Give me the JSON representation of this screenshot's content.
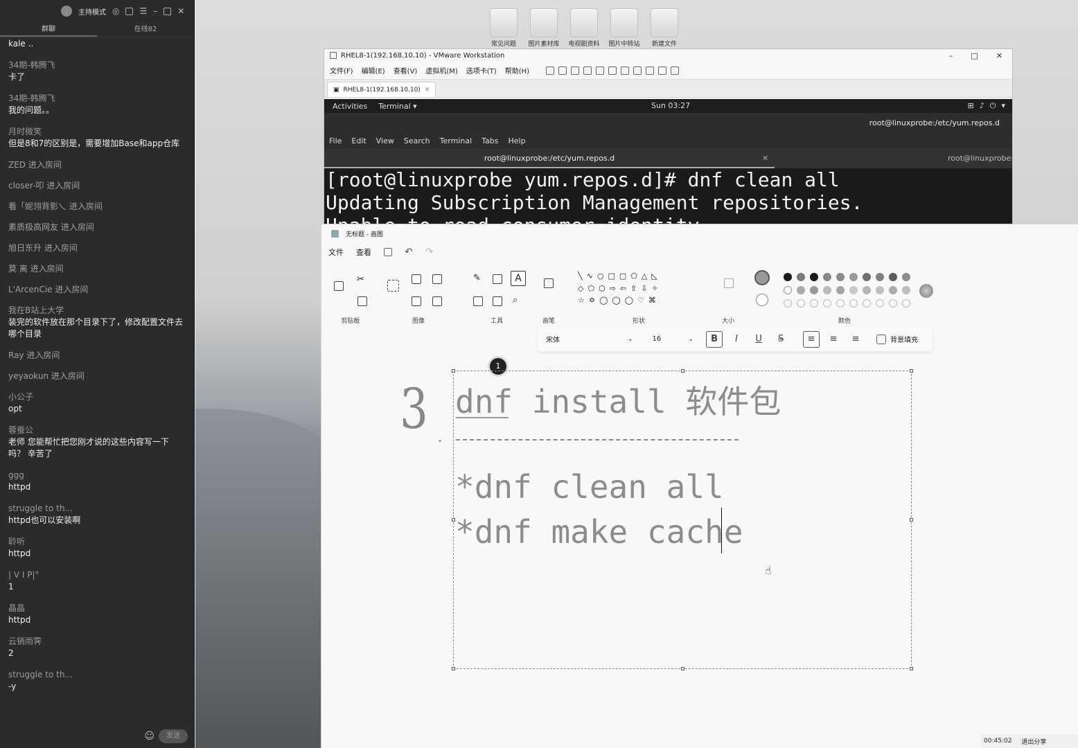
{
  "chat": {
    "header_title": "主持模式",
    "tabs": [
      "群聊",
      "在线82"
    ],
    "messages": [
      {
        "user": "34期-韩腾飞",
        "text": "kale .."
      },
      {
        "user": "34期-韩腾飞",
        "text": "卡了"
      },
      {
        "user": "34期-韩腾飞",
        "text": "我的问题。。"
      },
      {
        "user": "月时微笑",
        "text": "但是8和7的区别是，需要增加Base和app仓库"
      }
    ],
    "joins": [
      "ZED 进入房间",
      "closer-叩    进入房间",
      "看「妮翎背影乀 进入房间",
      "素质极高网友 进入房间",
      "旭日东升 进入房间",
      "莫 离 进入房间",
      "L'ArcenCie 进入房间"
    ],
    "messages2": [
      {
        "user": "我在B站上大学",
        "text": "装完的软件放在那个目录下了，修改配置文件去哪个目录"
      }
    ],
    "joins2": [
      "Ray 进入房间",
      "yeyaokun 进入房间"
    ],
    "messages3": [
      {
        "user": "小公子",
        "text": "opt"
      },
      {
        "user": "蓉蚕公",
        "text": "老师 您能帮忙把您刚才说的这些内容写一下吗？ 辛苦了"
      },
      {
        "user": "ggg",
        "text": "httpd"
      },
      {
        "user": "struggle to th...",
        "text": "httpd也可以安装啊"
      },
      {
        "user": "聆听",
        "text": "httpd"
      },
      {
        "user": "|      V      I      P|°",
        "text": "1"
      },
      {
        "user": "晶晶",
        "text": "httpd"
      },
      {
        "user": "云销雨霁",
        "text": "2"
      },
      {
        "user": "struggle to th...",
        "text": "-y"
      }
    ],
    "send_label": "发送",
    "emoji_icon": "smile-icon"
  },
  "desktop_icons": [
    "常见问题",
    "图片素材库",
    "电视剧资料",
    "图片中转站",
    "新建文件"
  ],
  "vmware": {
    "title": "RHEL8-1(192.168.10.10) - VMware Workstation",
    "menu": [
      "文件(F)",
      "编辑(E)",
      "查看(V)",
      "虚拟机(M)",
      "选项卡(T)",
      "帮助(H)"
    ],
    "vm_tab": "RHEL8-1(192.168.10.10)",
    "guest": {
      "activities": "Activities",
      "app_menu": "Terminal ▾",
      "clock": "Sun 03:27",
      "window_title": "root@linuxprobe:/etc/yum.repos.d",
      "term_menu": [
        "File",
        "Edit",
        "View",
        "Search",
        "Terminal",
        "Tabs",
        "Help"
      ],
      "tab1": "root@linuxprobe:/etc/yum.repos.d",
      "tab2": "root@linuxprobe:/",
      "lines": [
        "[root@linuxprobe yum.repos.d]# dnf clean all",
        "Updating Subscription Management repositories.",
        "Unable to read consumer identity"
      ]
    }
  },
  "paint": {
    "title": "无标题 - 画图",
    "menu": [
      "文件",
      "查看"
    ],
    "groups": [
      "剪贴板",
      "图像",
      "工具",
      "画笔",
      "形状",
      "大小",
      "颜色"
    ],
    "font_name": "宋体",
    "font_size": "16",
    "bg_fill_label": "背景填充",
    "badge": "1",
    "handwritten_number": "3",
    "text_lines": [
      "dnf install 软件包",
      "*dnf clean all",
      "*dnf make cache"
    ],
    "status_time": "00:45:02",
    "status_exit": "退出分享",
    "palette": [
      "#1a1a1a",
      "#7a7a7a",
      "#1a1a1a",
      "#888888",
      "#8a8a8a",
      "#9a9a9a",
      "#6f6f6f",
      "#808080",
      "#5e5e5e",
      "#8c8c8c"
    ]
  }
}
